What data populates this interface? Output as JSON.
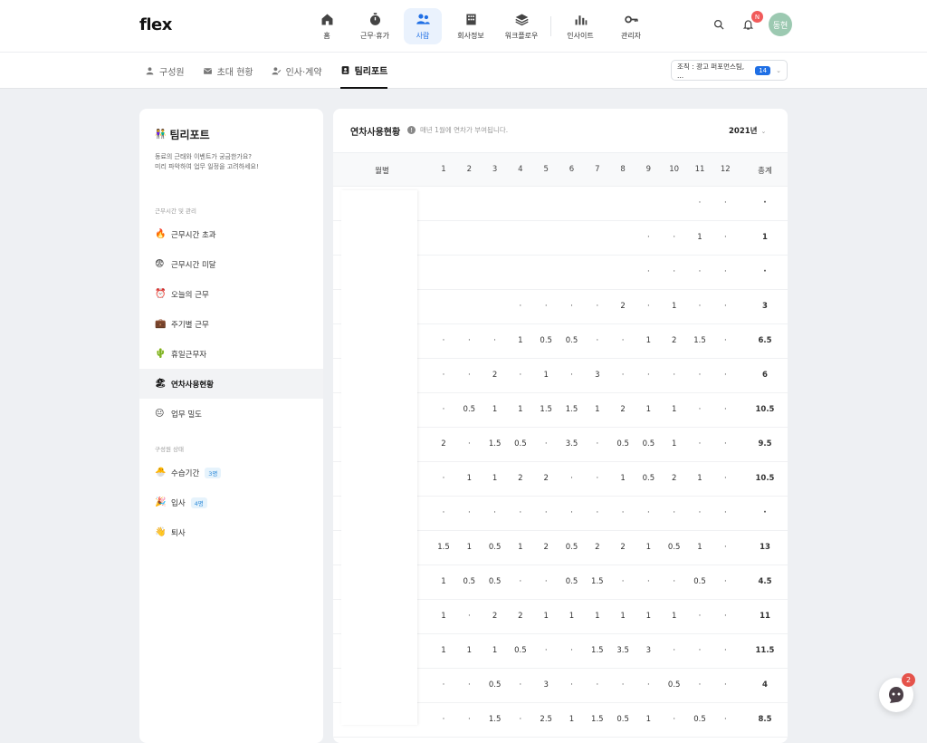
{
  "app": {
    "logo": "flex"
  },
  "nav": [
    {
      "label": "홈",
      "icon": "home-icon"
    },
    {
      "label": "근무·휴가",
      "icon": "stopwatch-icon"
    },
    {
      "label": "사람",
      "icon": "people-icon",
      "active": true
    },
    {
      "label": "회사정보",
      "icon": "building-icon"
    },
    {
      "label": "워크플로우",
      "icon": "layers-icon"
    },
    {
      "label": "인사이트",
      "icon": "bar-chart-icon"
    },
    {
      "label": "관리자",
      "icon": "key-icon"
    }
  ],
  "header": {
    "notif_badge": "N",
    "avatar_text": "동현"
  },
  "subtabs": [
    {
      "label": "구성원",
      "icon": "person-icon"
    },
    {
      "label": "초대 현황",
      "icon": "mail-icon"
    },
    {
      "label": "인사·계약",
      "icon": "person-sign-icon"
    },
    {
      "label": "팀리포트",
      "icon": "badge-icon",
      "active": true
    }
  ],
  "org_filter": {
    "label": "조직 : 광고 퍼포먼스팀, ...",
    "count": "14"
  },
  "sidebar": {
    "title": "팀리포트",
    "title_emoji": "👫",
    "desc_line1": "동료의 근태와 이벤트가 궁금한가요?",
    "desc_line2": "미리 파악하여 업무 일정을 고려하세요!",
    "group1": "근무시간 및 관리",
    "items1": [
      {
        "emoji": "🔥",
        "label": "근무시간 초과"
      },
      {
        "emoji": "😨",
        "label": "근무시간 미달"
      },
      {
        "emoji": "⏰",
        "label": "오늘의 근무"
      },
      {
        "emoji": "💼",
        "label": "주기별 근무"
      },
      {
        "emoji": "🌵",
        "label": "휴일근무자"
      },
      {
        "emoji": "🏖",
        "label": "연차사용현황",
        "active": true
      },
      {
        "emoji": "😐",
        "label": "업무 밀도"
      }
    ],
    "group2": "구성원 상태",
    "items2": [
      {
        "emoji": "🐣",
        "label": "수습기간",
        "badge": "3명"
      },
      {
        "emoji": "🎉",
        "label": "입사",
        "badge": "4명"
      },
      {
        "emoji": "👋",
        "label": "퇴사"
      }
    ]
  },
  "main": {
    "title": "연차사용현황",
    "info": "매년 1월에 연차가 부여됩니다.",
    "year": "2021년",
    "header_name": "월별",
    "months": [
      "1",
      "2",
      "3",
      "4",
      "5",
      "6",
      "7",
      "8",
      "9",
      "10",
      "11",
      "12"
    ],
    "header_total": "총계",
    "rows": [
      {
        "cells": [
          "",
          "",
          "",
          "",
          "",
          "",
          "",
          "",
          "",
          "",
          "·",
          "·"
        ],
        "total": "·"
      },
      {
        "cells": [
          "",
          "",
          "",
          "",
          "",
          "",
          "",
          "",
          "·",
          "·",
          "1",
          "·"
        ],
        "total": "1"
      },
      {
        "cells": [
          "",
          "",
          "",
          "",
          "",
          "",
          "",
          "",
          "·",
          "·",
          "·",
          "·"
        ],
        "total": "·"
      },
      {
        "cells": [
          "",
          "",
          "",
          "·",
          "·",
          "·",
          "·",
          "2",
          "·",
          "1",
          "·",
          "·"
        ],
        "total": "3"
      },
      {
        "cells": [
          "·",
          "·",
          "·",
          "1",
          "0.5",
          "0.5",
          "·",
          "·",
          "1",
          "2",
          "1.5",
          "·"
        ],
        "total": "6.5"
      },
      {
        "cells": [
          "·",
          "·",
          "2",
          "·",
          "1",
          "·",
          "3",
          "·",
          "·",
          "·",
          "·",
          "·"
        ],
        "total": "6"
      },
      {
        "cells": [
          "·",
          "0.5",
          "1",
          "1",
          "1.5",
          "1.5",
          "1",
          "2",
          "1",
          "1",
          "·",
          "·"
        ],
        "total": "10.5"
      },
      {
        "cells": [
          "2",
          "·",
          "1.5",
          "0.5",
          "·",
          "3.5",
          "·",
          "0.5",
          "0.5",
          "1",
          "·",
          "·"
        ],
        "total": "9.5"
      },
      {
        "cells": [
          "·",
          "1",
          "1",
          "2",
          "2",
          "·",
          "·",
          "1",
          "0.5",
          "2",
          "1",
          "·"
        ],
        "total": "10.5"
      },
      {
        "cells": [
          "·",
          "·",
          "·",
          "·",
          "·",
          "·",
          "·",
          "·",
          "·",
          "·",
          "·",
          "·"
        ],
        "total": "·"
      },
      {
        "cells": [
          "1.5",
          "1",
          "0.5",
          "1",
          "2",
          "0.5",
          "2",
          "2",
          "1",
          "0.5",
          "1",
          "·"
        ],
        "total": "13"
      },
      {
        "cells": [
          "1",
          "0.5",
          "0.5",
          "·",
          "·",
          "0.5",
          "1.5",
          "·",
          "·",
          "·",
          "0.5",
          "·"
        ],
        "total": "4.5"
      },
      {
        "cells": [
          "1",
          "·",
          "2",
          "2",
          "1",
          "1",
          "1",
          "1",
          "1",
          "1",
          "·",
          "·"
        ],
        "total": "11"
      },
      {
        "cells": [
          "1",
          "1",
          "1",
          "0.5",
          "·",
          "·",
          "1.5",
          "3.5",
          "3",
          "·",
          "·",
          "·"
        ],
        "total": "11.5"
      },
      {
        "cells": [
          "·",
          "·",
          "0.5",
          "·",
          "3",
          "·",
          "·",
          "·",
          "·",
          "0.5",
          "·",
          "·"
        ],
        "total": "4"
      },
      {
        "cells": [
          "·",
          "·",
          "1.5",
          "·",
          "2.5",
          "1",
          "1.5",
          "0.5",
          "1",
          "·",
          "0.5",
          "·"
        ],
        "total": "8.5"
      }
    ]
  },
  "chat": {
    "badge": "2"
  }
}
